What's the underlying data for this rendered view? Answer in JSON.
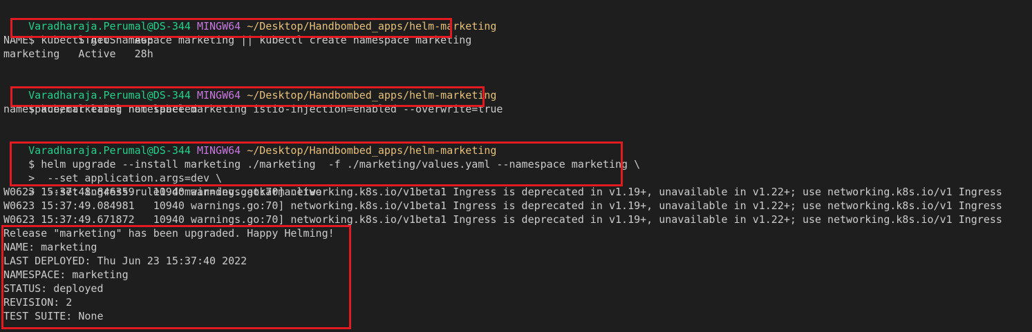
{
  "prompt": {
    "user": "Varadharaja.Perumal@DS-344",
    "system": "MINGW64",
    "path": "~/Desktop/Handbombed_apps/helm-marketing",
    "symbol": "$",
    "continuation": ">"
  },
  "block1": {
    "command": "kubectl get namespace marketing || kubectl create namespace marketing",
    "output": [
      "NAME        STATUS   AGE",
      "marketing   Active   28h"
    ]
  },
  "block2": {
    "command": "kubectl label namespace marketing istio-injection=enabled --overwrite=true",
    "output": [
      "namespace/marketing not labeled"
    ]
  },
  "block3": {
    "command_lines": [
      "helm upgrade --install marketing ./marketing  -f ./marketing/values.yaml --namespace marketing \\",
      " --set application.args=dev \\",
      " --set ingress.rule1.domain=dev.getkarma.live"
    ],
    "warnings": [
      "W0623 15:37:48.846359   10940 warnings.go:70] networking.k8s.io/v1beta1 Ingress is deprecated in v1.19+, unavailable in v1.22+; use networking.k8s.io/v1 Ingress",
      "W0623 15:37:49.084981   10940 warnings.go:70] networking.k8s.io/v1beta1 Ingress is deprecated in v1.19+, unavailable in v1.22+; use networking.k8s.io/v1 Ingress",
      "W0623 15:37:49.671872   10940 warnings.go:70] networking.k8s.io/v1beta1 Ingress is deprecated in v1.19+, unavailable in v1.22+; use networking.k8s.io/v1 Ingress"
    ],
    "result": [
      "Release \"marketing\" has been upgraded. Happy Helming!",
      "NAME: marketing",
      "LAST DEPLOYED: Thu Jun 23 15:37:40 2022",
      "NAMESPACE: marketing",
      "STATUS: deployed",
      "REVISION: 2",
      "TEST SUITE: None"
    ]
  },
  "colors": {
    "background": "#1e1e1e",
    "text": "#cccccc",
    "prompt_user": "#23d18b",
    "prompt_system": "#c678dd",
    "prompt_path": "#e5c07b",
    "highlight_border": "#e21b23"
  }
}
